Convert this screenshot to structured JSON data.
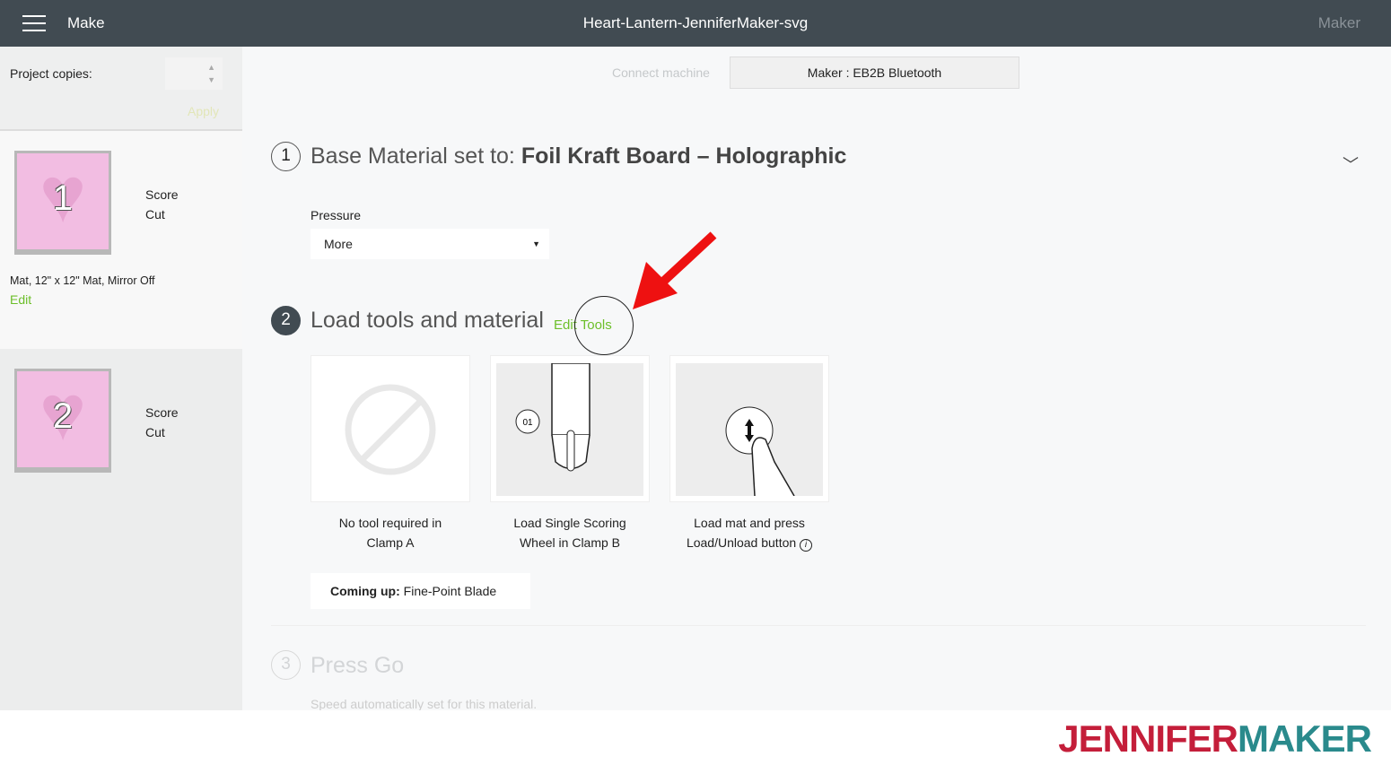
{
  "header": {
    "menu_icon": "hamburger-icon",
    "section": "Make",
    "title": "Heart-Lantern-JenniferMaker-svg",
    "account": "Maker"
  },
  "sidebar": {
    "copies_label": "Project copies:",
    "copies_value": "",
    "apply_label": "Apply",
    "mats": [
      {
        "number": "1",
        "operations": [
          "Score",
          "Cut"
        ],
        "info": "Mat, 12\" x 12\" Mat, Mirror Off",
        "edit_label": "Edit"
      },
      {
        "number": "2",
        "operations": [
          "Score",
          "Cut"
        ]
      }
    ]
  },
  "main": {
    "connect_label": "Connect machine",
    "machine": "Maker : EB2B Bluetooth",
    "step1": {
      "number": "1",
      "prefix": "Base Material set to: ",
      "material": "Foil Kraft Board  – Holographic",
      "pressure_label": "Pressure",
      "pressure_value": "More"
    },
    "step2": {
      "number": "2",
      "title": "Load tools and material",
      "edit_tools": "Edit Tools",
      "cards": [
        {
          "icon": "no-tool-icon",
          "line1": "No tool required in",
          "line2": "Clamp A"
        },
        {
          "icon": "scoring-wheel-icon",
          "badge": "01",
          "line1": "Load Single Scoring",
          "line2": "Wheel in Clamp B"
        },
        {
          "icon": "load-button-icon",
          "line1": "Load mat and press",
          "line2": "Load/Unload button"
        }
      ],
      "coming_label": "Coming up:",
      "coming_value": "Fine-Point Blade"
    },
    "step3": {
      "number": "3",
      "title": "Press Go",
      "speed": "Speed automatically set for this material."
    }
  },
  "footer": {
    "logo_part1": "JENNIFER",
    "logo_part2": "MAKER"
  },
  "colors": {
    "header": "#414b52",
    "accent_green": "#6cbf2a",
    "annotation_arrow": "#ee1111"
  }
}
